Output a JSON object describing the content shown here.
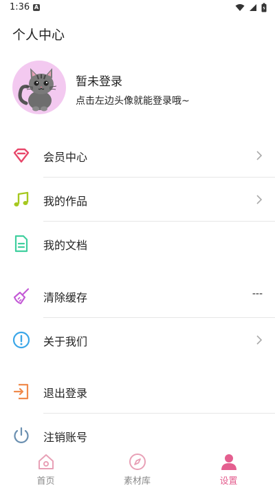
{
  "status_bar": {
    "time": "1:36",
    "a_badge": "A"
  },
  "page_title": "个人中心",
  "profile": {
    "name": "暂未登录",
    "hint": "点击左边头像就能登录哦~"
  },
  "menu": {
    "vip": {
      "label": "会员中心",
      "icon": "diamond-icon",
      "color": "#e8476a"
    },
    "works": {
      "label": "我的作品",
      "icon": "music-note-icon",
      "color": "#a6c81f"
    },
    "docs": {
      "label": "我的文档",
      "icon": "document-icon",
      "color": "#3fcf9e"
    },
    "cache": {
      "label": "清除缓存",
      "icon": "broom-icon",
      "color": "#c35ad6",
      "value": "---"
    },
    "about": {
      "label": "关于我们",
      "icon": "info-icon",
      "color": "#3aa6e8"
    },
    "logout": {
      "label": "退出登录",
      "icon": "exit-icon",
      "color": "#f08a4b"
    },
    "cancel": {
      "label": "注销账号",
      "icon": "power-icon",
      "color": "#6a8fb0"
    }
  },
  "bottom_nav": {
    "home": {
      "label": "首页",
      "icon": "home-icon"
    },
    "materials": {
      "label": "素材库",
      "icon": "compass-icon"
    },
    "settings": {
      "label": "设置",
      "icon": "user-icon",
      "active": true
    }
  },
  "colors": {
    "accent": "#e45f8f",
    "divider": "#e6e6e6",
    "inactive": "#888888"
  }
}
